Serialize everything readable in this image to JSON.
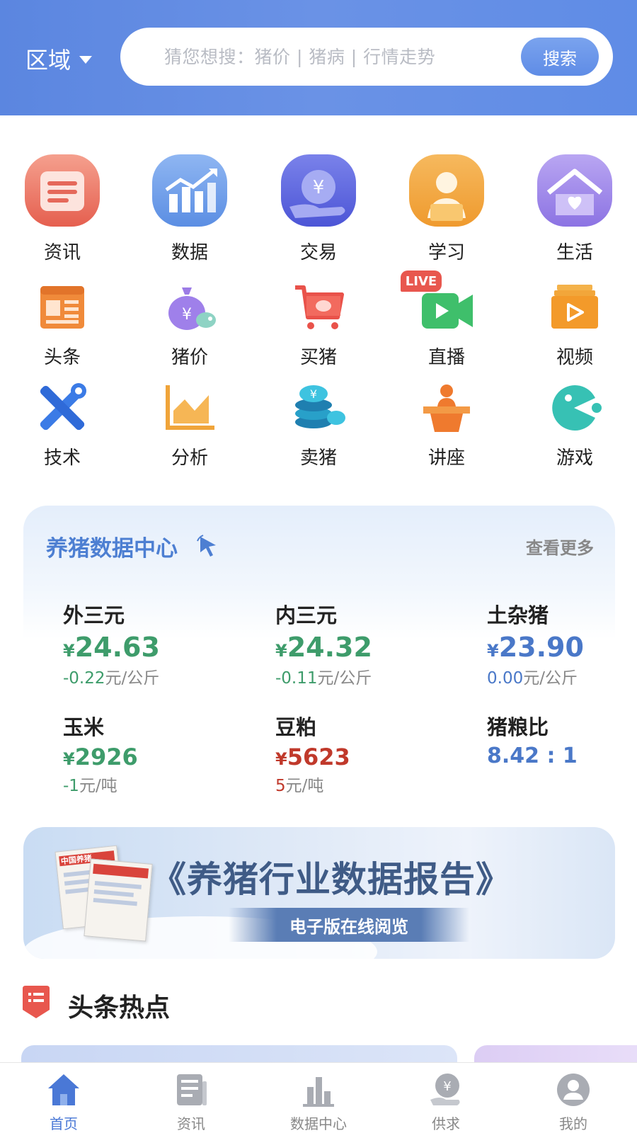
{
  "header": {
    "region_label": "区域",
    "search_placeholder": "猜您想搜：猪价 | 猪病 | 行情走势",
    "search_button": "搜索"
  },
  "big_icons": [
    {
      "label": "资讯",
      "icon": "news-icon"
    },
    {
      "label": "数据",
      "icon": "chart-icon"
    },
    {
      "label": "交易",
      "icon": "yuan-hand-icon"
    },
    {
      "label": "学习",
      "icon": "reader-icon"
    },
    {
      "label": "生活",
      "icon": "house-heart-icon"
    }
  ],
  "small_icons_row1": [
    {
      "label": "头条",
      "icon": "headline-icon"
    },
    {
      "label": "猪价",
      "icon": "money-bag-pig-icon"
    },
    {
      "label": "买猪",
      "icon": "cart-pig-icon"
    },
    {
      "label": "直播",
      "icon": "live-camera-icon",
      "badge": "LIVE"
    },
    {
      "label": "视频",
      "icon": "video-folder-icon"
    }
  ],
  "small_icons_row2": [
    {
      "label": "技术",
      "icon": "tools-icon"
    },
    {
      "label": "分析",
      "icon": "area-chart-icon"
    },
    {
      "label": "卖猪",
      "icon": "coins-pig-icon"
    },
    {
      "label": "讲座",
      "icon": "lecture-icon"
    },
    {
      "label": "游戏",
      "icon": "game-icon"
    }
  ],
  "data_center": {
    "title": "养猪数据中心",
    "more": "查看更多",
    "currency": "¥",
    "metrics": [
      {
        "name": "外三元",
        "value": "24.63",
        "change": "-0.22",
        "unit": "元/公斤",
        "color": "#3e9c6b"
      },
      {
        "name": "内三元",
        "value": "24.32",
        "change": "-0.11",
        "unit": "元/公斤",
        "color": "#3e9c6b"
      },
      {
        "name": "土杂猪",
        "value": "23.90",
        "change": "0.00",
        "unit": "元/公斤",
        "color": "#4a78c8"
      },
      {
        "name": "玉米",
        "value": "2926",
        "change": "-1",
        "unit": "元/吨",
        "color": "#3e9c6b"
      },
      {
        "name": "豆粕",
        "value": "5623",
        "change": "5",
        "unit": "元/吨",
        "color": "#c0392b"
      },
      {
        "name": "猪粮比",
        "value": "8.42 : 1",
        "color": "#4a78c8"
      }
    ]
  },
  "banner": {
    "title": "《养猪行业数据报告》",
    "subtitle": "电子版在线阅览",
    "magazine_text": "中国养猪"
  },
  "headlines": {
    "title": "头条热点"
  },
  "tabbar": [
    {
      "label": "首页",
      "icon": "home-icon",
      "active": true
    },
    {
      "label": "资讯",
      "icon": "news-icon"
    },
    {
      "label": "数据中心",
      "icon": "bar-chart-icon"
    },
    {
      "label": "供求",
      "icon": "yuan-hand-icon"
    },
    {
      "label": "我的",
      "icon": "user-icon"
    }
  ]
}
